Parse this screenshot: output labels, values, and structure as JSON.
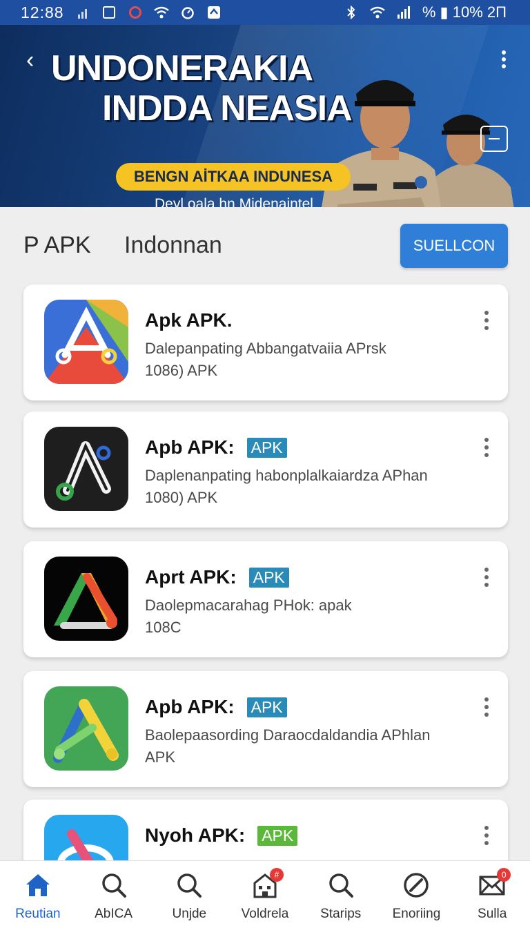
{
  "status_bar": {
    "time": "12:88",
    "right_text": "% ▮ 10% 2Π"
  },
  "banner": {
    "title_line1": "UNDONERAKIA",
    "title_line2": "INDDA NEASIA",
    "pill_text": "BENGN AİTKAA INDUNESA",
    "subtitle": "Deyl oala hn Midenaintel"
  },
  "header": {
    "title": "P APK",
    "subtitle": "Indonnan",
    "action_label": "SUELLCON"
  },
  "apps": [
    {
      "name": "Apk APK.",
      "badge": "",
      "description": "Dalepanpating Abbangatvaiia APrsk",
      "size": "1086) APK",
      "badge_color": ""
    },
    {
      "name": "Apb APK:",
      "badge": "APK",
      "description": "Daplenanpating habonplalkaiardza APhan",
      "size": "1080) APK",
      "badge_color": "#2a8ab8"
    },
    {
      "name": "Aprt APK:",
      "badge": "APK",
      "description": "Daolepmacarahag PHok: apak",
      "size": "108C",
      "badge_color": "#2a8ab8"
    },
    {
      "name": "Apb APK:",
      "badge": "APK",
      "description": "Baolepaasording Daraocdaldandia APhlan",
      "size": "APK",
      "badge_color": "#2a8ab8"
    },
    {
      "name": "Nyoh APK:",
      "badge": "APK",
      "description": "",
      "size": "",
      "badge_color": "#5cb83a"
    }
  ],
  "bottom_nav": [
    {
      "label": "Reutian",
      "icon": "home-icon",
      "active": true,
      "badge": ""
    },
    {
      "label": "AbICA",
      "icon": "search-icon",
      "active": false,
      "badge": ""
    },
    {
      "label": "Unjde",
      "icon": "search-icon",
      "active": false,
      "badge": ""
    },
    {
      "label": "Voldrela",
      "icon": "building-icon",
      "active": false,
      "badge": "#"
    },
    {
      "label": "Starips",
      "icon": "search-icon",
      "active": false,
      "badge": ""
    },
    {
      "label": "Enoriing",
      "icon": "compass-icon",
      "active": false,
      "badge": ""
    },
    {
      "label": "Sulla",
      "icon": "mail-icon",
      "active": false,
      "badge": "0"
    }
  ],
  "colors": {
    "primary": "#2f7fd8",
    "status_bar": "#1f4fa0",
    "pill": "#f6c325",
    "badge_blue": "#2a8ab8",
    "badge_green": "#5cb83a"
  }
}
